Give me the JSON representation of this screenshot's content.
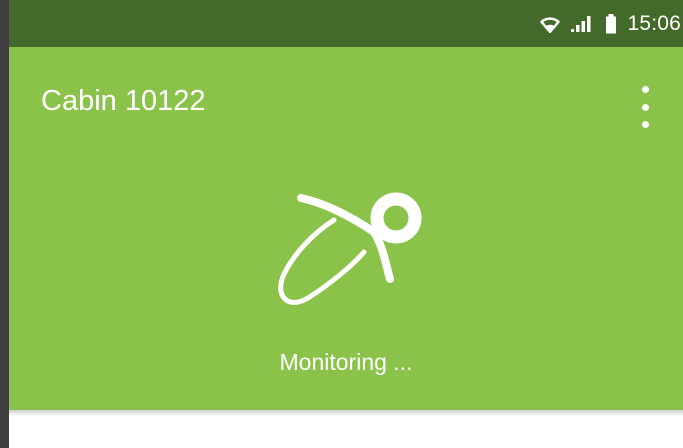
{
  "status_bar": {
    "time": "15:06",
    "icons": [
      "wifi-icon",
      "signal-icon",
      "battery-icon"
    ]
  },
  "app_bar": {
    "title": "Cabin 10122",
    "menu_icon": "more-vert-icon"
  },
  "hero": {
    "icon": "pacifier-icon",
    "status_text": "Monitoring ..."
  },
  "colors": {
    "status_bar": "#446a2b",
    "primary": "#8bc34a",
    "text": "#ffffff"
  }
}
